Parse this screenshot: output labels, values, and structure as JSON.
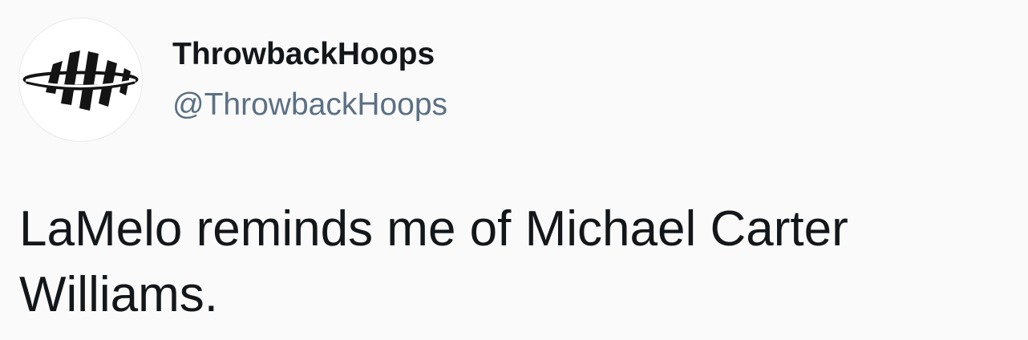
{
  "tweet": {
    "author": {
      "display_name": "ThrowbackHoops",
      "handle": "@ThrowbackHoops",
      "avatar_icon": "basketball-stripes-logo-icon"
    },
    "text": "LaMelo reminds me of Michael Carter Williams."
  },
  "colors": {
    "background": "#fafafb",
    "text": "#14171a",
    "handle": "#5b7083",
    "logo": "#141414"
  }
}
